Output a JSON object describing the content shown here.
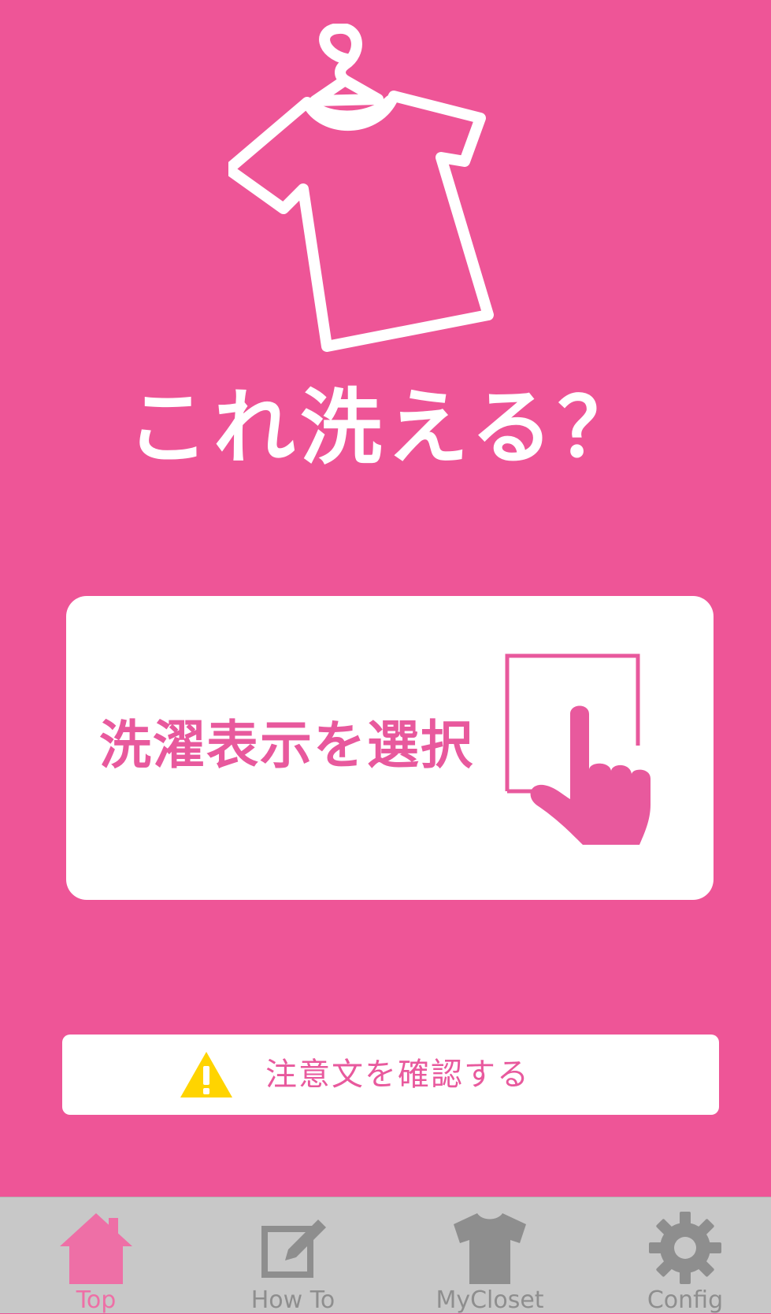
{
  "app": {
    "title": "これ洗える？",
    "logo_icon": "shirt-on-hanger-icon"
  },
  "main": {
    "select_button_label": "洗濯表示を選択",
    "select_button_icon": "tap-hand-icon",
    "notice_button_label": "注意文を確認する",
    "notice_button_icon": "warning-icon"
  },
  "tabbar": {
    "active_tab": "Top",
    "tabs": [
      {
        "label": "Top",
        "icon": "home-icon",
        "active": true
      },
      {
        "label": "How To",
        "icon": "edit-icon",
        "active": false
      },
      {
        "label": "MyCloset",
        "icon": "tshirt-icon",
        "active": false
      },
      {
        "label": "Config",
        "icon": "gear-icon",
        "active": false
      }
    ]
  },
  "colors": {
    "background": "#EE5597",
    "accent_text": "#E8599D",
    "tab_bar": "#C8C8C8",
    "tab_inactive": "#8E8E8E",
    "tab_active": "#EE6FA6",
    "warning": "#FFD400"
  }
}
